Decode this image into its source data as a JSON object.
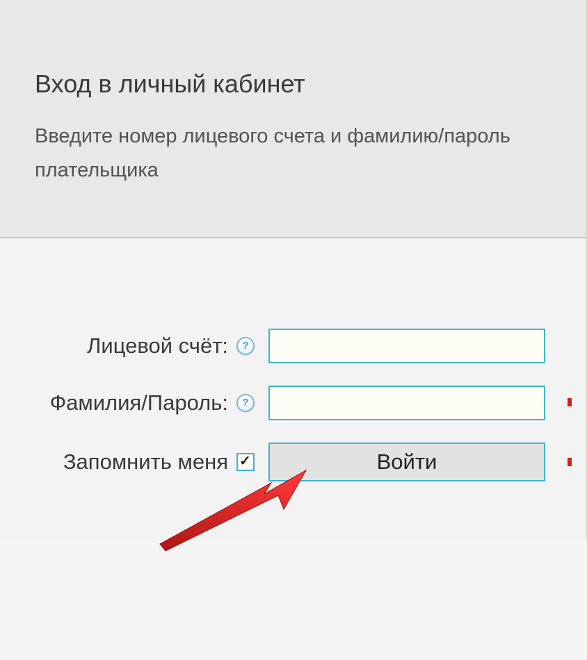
{
  "header": {
    "title": "Вход в личный кабинет",
    "subtitle": "Введите номер лицевого счета и фамилию/пароль плательщика"
  },
  "form": {
    "account_label": "Лицевой счёт:",
    "password_label": "Фамилия/Пароль:",
    "remember_label": "Запомнить меня",
    "login_button": "Войти",
    "help_glyph": "?",
    "account_value": "",
    "password_value": "",
    "remember_checked": true
  }
}
